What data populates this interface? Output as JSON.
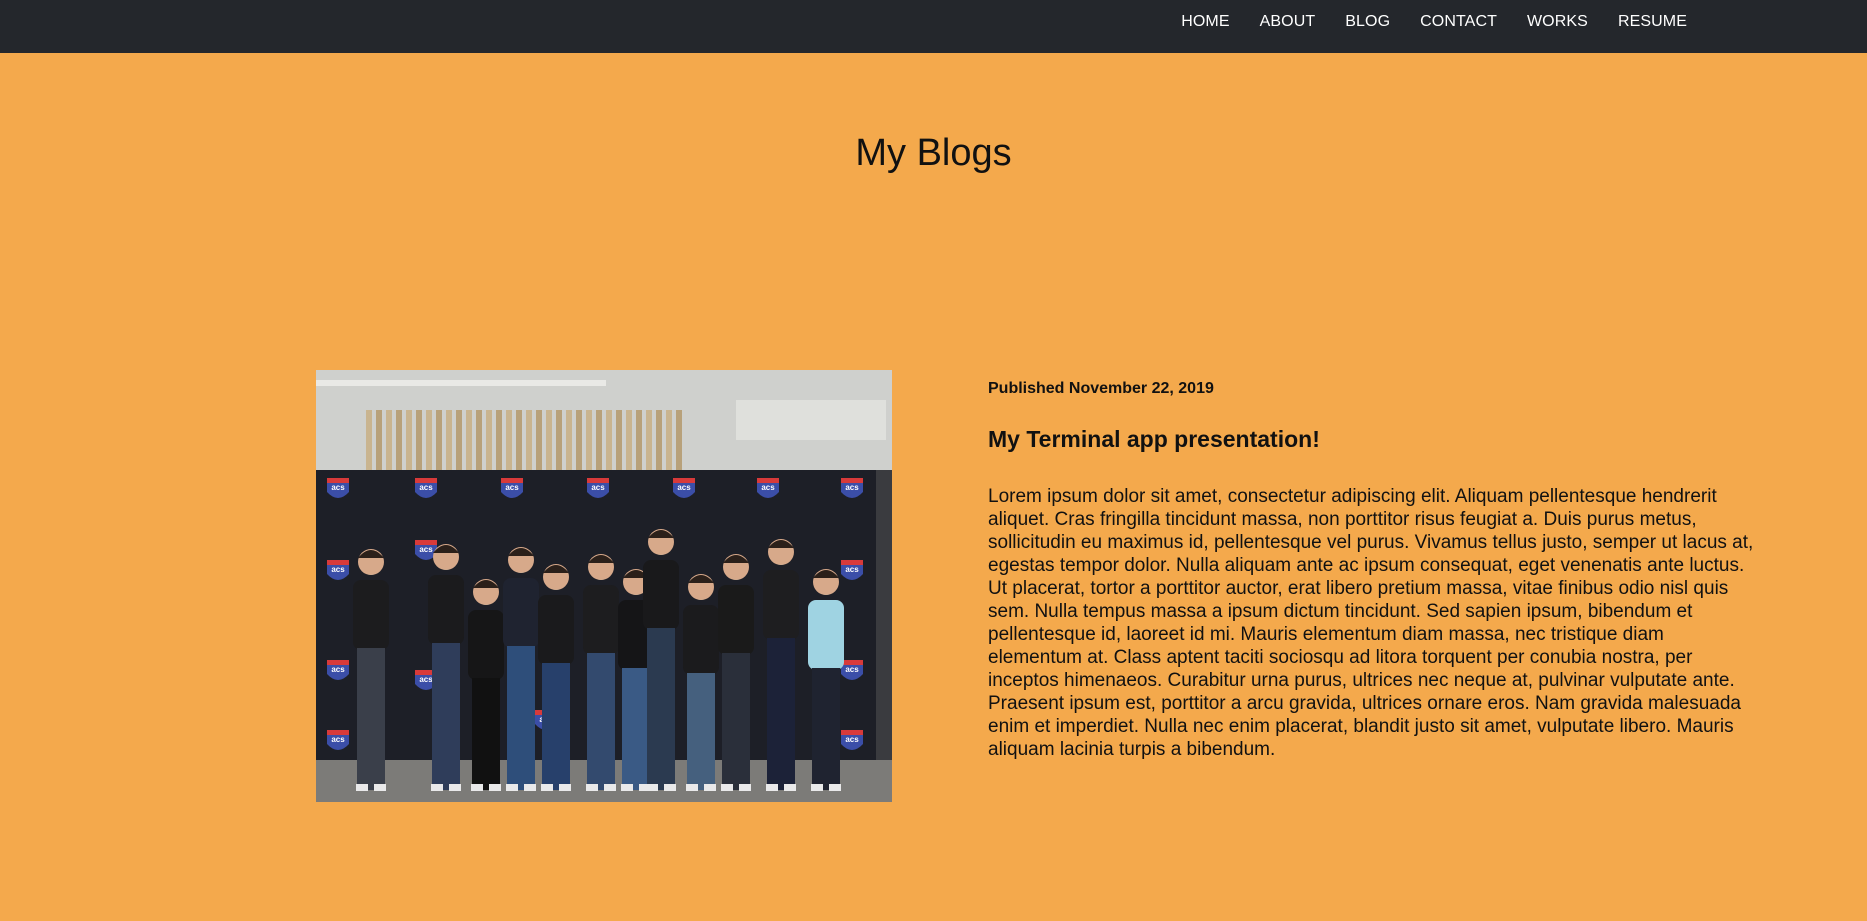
{
  "nav": {
    "items": [
      {
        "label": "HOME"
      },
      {
        "label": "ABOUT"
      },
      {
        "label": "BLOG"
      },
      {
        "label": "CONTACT"
      },
      {
        "label": "WORKS"
      },
      {
        "label": "RESUME"
      }
    ]
  },
  "page": {
    "title": "My Blogs"
  },
  "post": {
    "published": "Published November 22, 2019",
    "title": "My Terminal app presentation!",
    "body": "Lorem ipsum dolor sit amet, consectetur adipiscing elit. Aliquam pellentesque hendrerit aliquet. Cras fringilla tincidunt massa, non porttitor risus feugiat a. Duis purus metus, sollicitudin eu maximus id, pellentesque vel purus. Vivamus tellus justo, semper ut lacus at, egestas tempor dolor. Nulla aliquam ante ac ipsum consequat, eget venenatis ante luctus. Ut placerat, tortor a porttitor auctor, erat libero pretium massa, vitae finibus odio nisl quis sem. Nulla tempus massa a ipsum dictum tincidunt. Sed sapien ipsum, bibendum et pellentesque id, laoreet id mi. Mauris elementum diam massa, nec tristique diam elementum at. Class aptent taciti sociosqu ad litora torquent per conubia nostra, per inceptos himenaeos. Curabitur urna purus, ultrices nec neque at, pulvinar vulputate ante. Praesent ipsum est, porttitor a arcu gravida, ultrices ornare eros. Nam gravida malesuada enim et imperdiet. Nulla nec enim placerat, blandit justo sit amet, vulputate libero. Mauris aliquam lacinia turpis a bibendum.",
    "image_alt": "group photo in front of acs backdrop",
    "backdrop_logo_text": "acs"
  },
  "colors": {
    "background": "#f4a94c",
    "navbar": "#24272c",
    "nav_text": "#ffffff"
  }
}
